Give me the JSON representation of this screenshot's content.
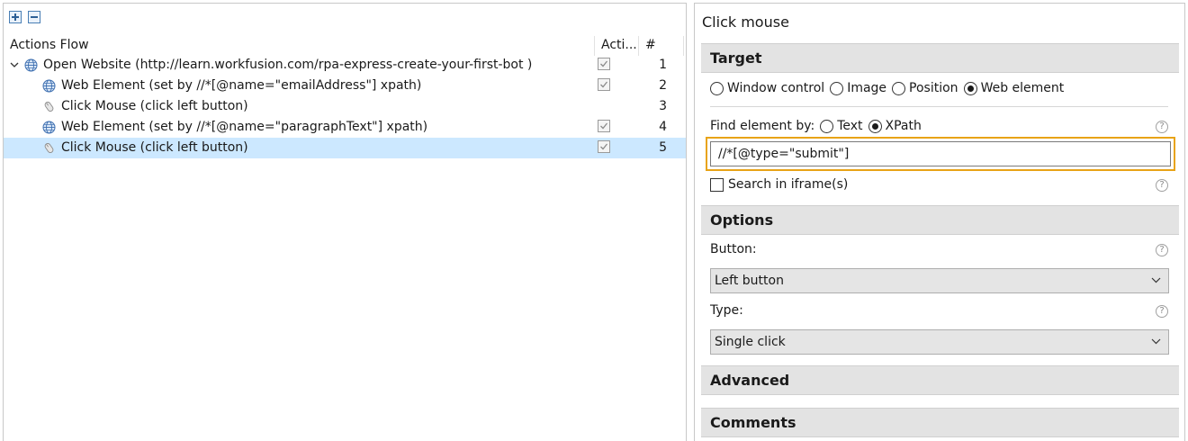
{
  "left": {
    "toolbar": {
      "expand_icon": "expand-all-icon",
      "collapse_icon": "collapse-all-icon"
    },
    "columns": {
      "flow": "Actions Flow",
      "active": "Acti...",
      "num": "#"
    },
    "rows": [
      {
        "label": "Open Website (http://learn.workfusion.com/rpa-express-create-your-first-bot )",
        "num": "1",
        "icon": "globe-icon",
        "level": 0
      },
      {
        "label": "Web Element (set by //*[@name=\"emailAddress\"] xpath)",
        "num": "2",
        "icon": "globe-icon",
        "level": 1
      },
      {
        "label": "Click Mouse (click left button)",
        "num": "3",
        "icon": "mouse-icon",
        "level": 1
      },
      {
        "label": "Web Element (set by //*[@name=\"paragraphText\"] xpath)",
        "num": "4",
        "icon": "globe-icon",
        "level": 1
      },
      {
        "label": "Click Mouse (click left button)",
        "num": "5",
        "icon": "mouse-icon",
        "level": 1,
        "selected": true
      }
    ]
  },
  "right": {
    "title": "Click mouse",
    "target": {
      "heading": "Target",
      "modes": [
        "Window control",
        "Image",
        "Position",
        "Web element"
      ],
      "selected_mode": "Web element",
      "find_by_label": "Find element by:",
      "find_by_options": [
        "Text",
        "XPath"
      ],
      "find_by_selected": "XPath",
      "xpath_value": "//*[@type=\"submit\"]",
      "iframe_label": "Search in iframe(s)"
    },
    "options": {
      "heading": "Options",
      "button_label": "Button:",
      "button_value": "Left button",
      "type_label": "Type:",
      "type_value": "Single click"
    },
    "advanced": {
      "heading": "Advanced"
    },
    "comments": {
      "heading": "Comments"
    },
    "help_glyph": "?"
  },
  "colors": {
    "selection": "#cce8ff",
    "focus_border": "#e8a317",
    "section_bg": "#e3e3e3"
  }
}
